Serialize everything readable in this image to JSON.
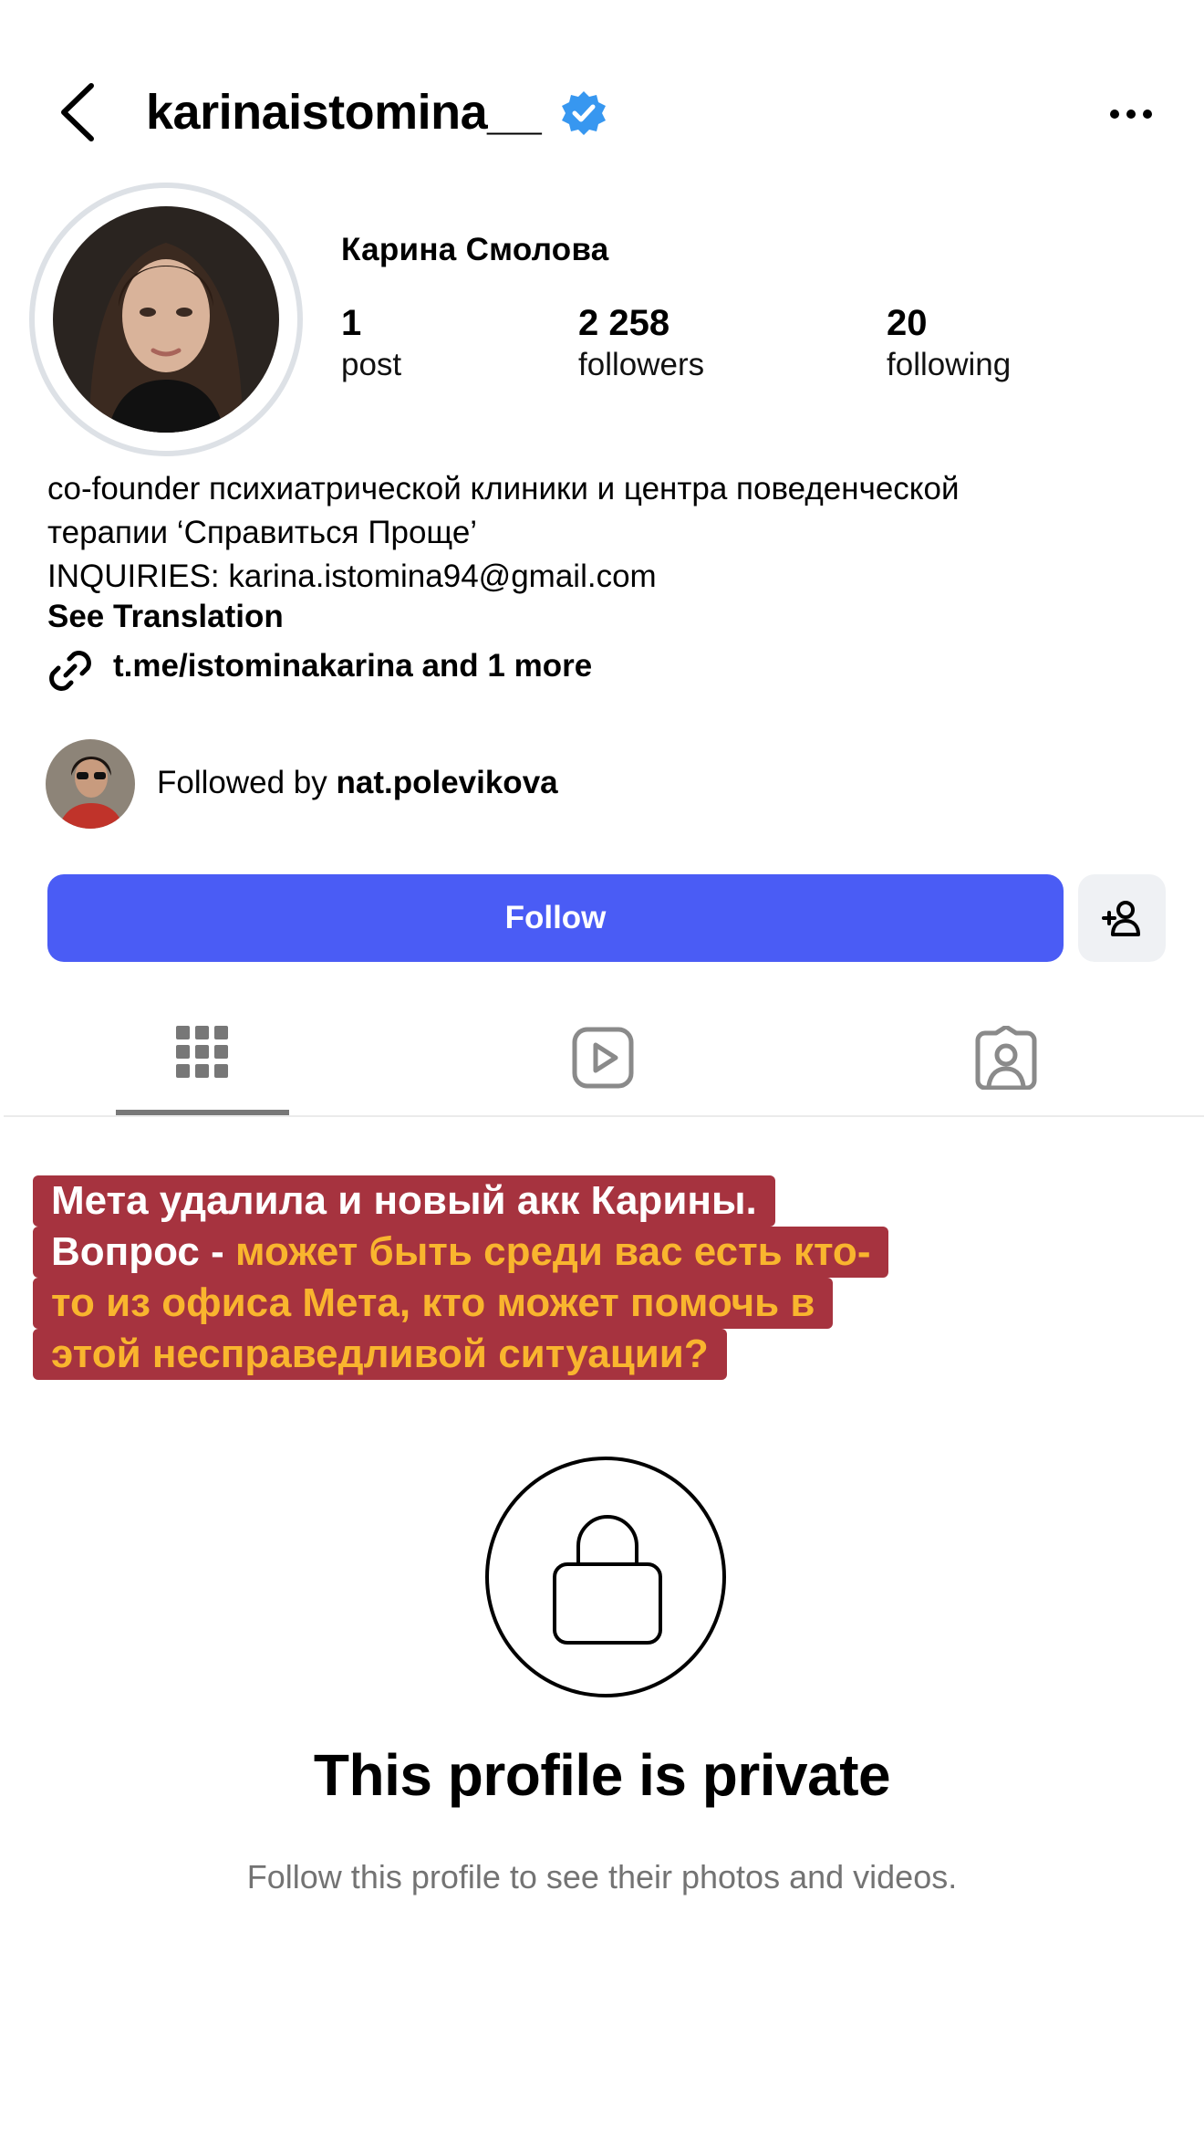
{
  "header": {
    "username": "karinaistomina__",
    "verified": true,
    "back_icon": "chevron-left-icon",
    "more_icon": "ellipsis-icon",
    "verified_color": "#3797f0"
  },
  "profile": {
    "display_name": "Карина Смолова",
    "stats": [
      {
        "value": "1",
        "label": "post"
      },
      {
        "value": "2 258",
        "label": "followers"
      },
      {
        "value": "20",
        "label": "following"
      }
    ],
    "bio_lines": [
      "co-founder психиатрической клиники и центра поведенческой",
      "терапии ‘Справиться Проще’",
      "INQUIRIES: karina.istomina94@gmail.com"
    ],
    "see_translation": "See Translation",
    "link_text": "t.me/istominakarina and 1 more",
    "followed_by_prefix": "Followed by ",
    "followed_by_user": "nat.polevikova"
  },
  "actions": {
    "follow_label": "Follow",
    "follow_color": "#4a5cf5",
    "add_person_icon": "add-person-icon"
  },
  "tabs": [
    {
      "name": "grid",
      "icon": "grid-icon",
      "active": true
    },
    {
      "name": "reels",
      "icon": "reels-icon",
      "active": false
    },
    {
      "name": "tagged",
      "icon": "tagged-icon",
      "active": false
    }
  ],
  "caption": {
    "lines": [
      {
        "plain": "Мета удалила и новый акк Карины.",
        "highlight": ""
      },
      {
        "plain": "Вопрос - ",
        "highlight": "может быть среди вас есть кто-"
      },
      {
        "plain": "",
        "highlight": "то из офиса Мета, кто может помочь в"
      },
      {
        "plain": "",
        "highlight": "этой несправедливой ситуации?"
      }
    ],
    "background_color": "#a6333f",
    "highlight_color": "#f9b52e"
  },
  "private": {
    "icon": "lock-icon",
    "title": "This profile is private",
    "subtitle": "Follow this profile to see their photos and videos."
  }
}
